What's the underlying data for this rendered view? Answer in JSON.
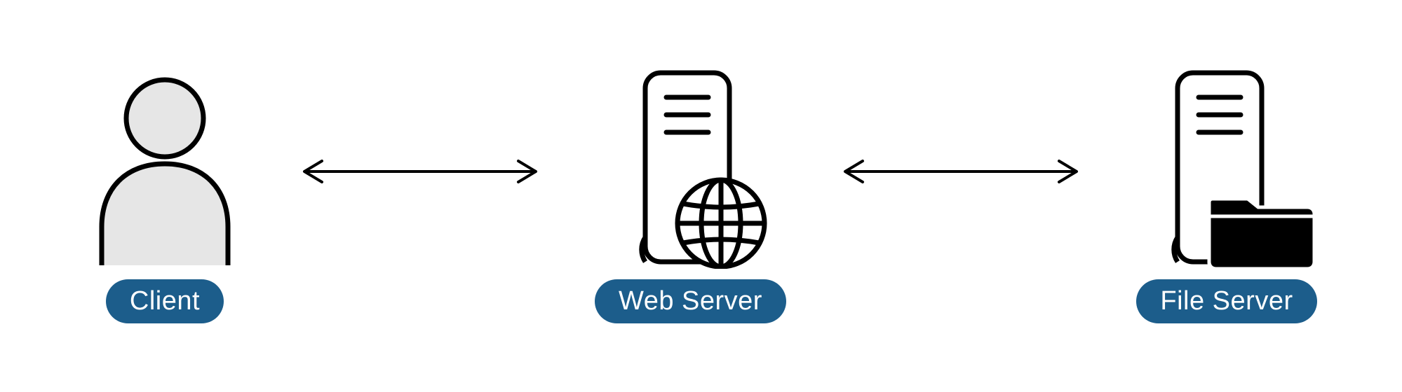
{
  "nodes": {
    "client": {
      "label": "Client",
      "icon": "person-icon"
    },
    "web_server": {
      "label": "Web Server",
      "icon": "web-server-icon"
    },
    "file_server": {
      "label": "File Server",
      "icon": "file-server-icon"
    }
  },
  "arrows": {
    "client_web": {
      "direction": "bidirectional"
    },
    "web_file": {
      "direction": "bidirectional"
    }
  },
  "colors": {
    "label_bg": "#1c5d8b",
    "label_fg": "#ffffff",
    "stroke": "#000000",
    "person_fill": "#e6e6e6"
  }
}
